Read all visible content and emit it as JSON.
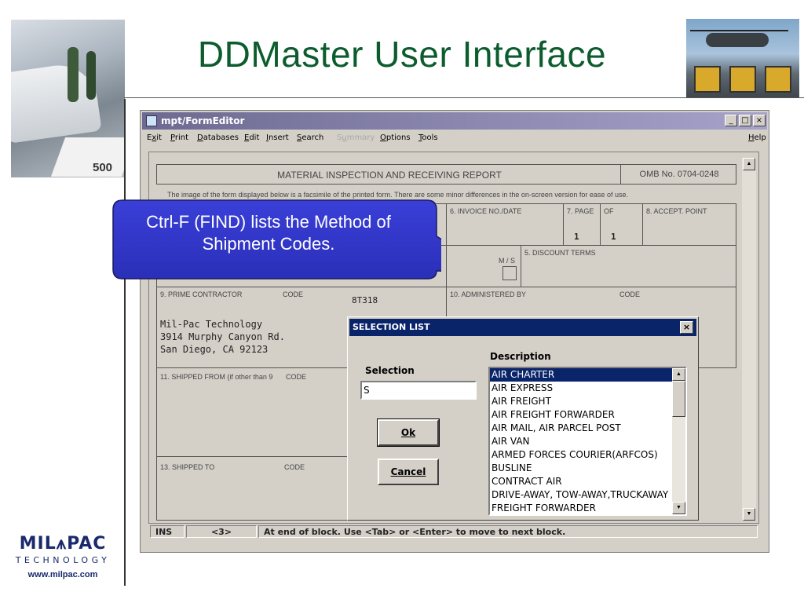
{
  "slide": {
    "title": "DDMaster User Interface",
    "logo_main": "MIL⩚PAC",
    "logo_sub": "TECHNOLOGY",
    "logo_url": "www.milpac.com",
    "photo_num": "500"
  },
  "window": {
    "title": "mpt/FormEditor",
    "min_glyph": "_",
    "max_glyph": "□",
    "close_glyph": "×",
    "menu": {
      "exit": "Exit",
      "print": "Print",
      "databases": "Databases",
      "edit": "Edit",
      "insert": "Insert",
      "search": "Search",
      "summary": "Summary",
      "options": "Options",
      "tools": "Tools",
      "help": "Help"
    }
  },
  "form": {
    "header_title": "MATERIAL INSPECTION AND RECEIVING REPORT",
    "omb": "OMB No. 0704-0248",
    "notice": "The image of the form displayed below is a facsimile of the printed form.  There are some minor differences in the on-screen version for ease of use.",
    "invoice_label": "6. INVOICE NO./DATE",
    "page_label": "7. PAGE",
    "of_label": "OF",
    "accept_label": "8. ACCEPT. POINT",
    "page_value": "1",
    "of_value": "1",
    "ms_label": "M / S",
    "discount_label": "5. DISCOUNT TERMS",
    "prime_label": "9. PRIME CONTRACTOR",
    "code_label": "CODE",
    "prime_code": "8T318",
    "admin_label": "10. ADMINISTERED BY",
    "admin_code_label": "CODE",
    "address_line1": "Mil-Pac Technology",
    "address_line2": "3914 Murphy Canyon Rd.",
    "address_line3": "San Diego,  CA  92123",
    "shipped_from_label": "11. SHIPPED FROM (if other than 9",
    "shipped_from_code": "CODE",
    "shipped_to_label": "13. SHIPPED TO",
    "shipped_to_code": "CODE"
  },
  "status": {
    "mode": "INS",
    "block": "<3>",
    "message": "At end of block.  Use <Tab> or <Enter> to move to next block."
  },
  "callout": {
    "text": "Ctrl-F (FIND) lists the Method of Shipment Codes."
  },
  "dialog": {
    "title": "SELECTION LIST",
    "close_glyph": "×",
    "selection_label": "Selection",
    "selection_value": "S",
    "description_label": "Description",
    "ok_label": "Ok",
    "cancel_label": "Cancel",
    "items": [
      "AIR CHARTER",
      "AIR EXPRESS",
      "AIR FREIGHT",
      "AIR FREIGHT FORWARDER",
      "AIR MAIL, AIR PARCEL POST",
      "AIR VAN",
      "ARMED FORCES COURIER(ARFCOS)",
      "BUSLINE",
      "CONTRACT AIR",
      "DRIVE-AWAY, TOW-AWAY,TRUCKAWAY",
      "FREIGHT FORWARDER"
    ],
    "selected_index": 0
  }
}
